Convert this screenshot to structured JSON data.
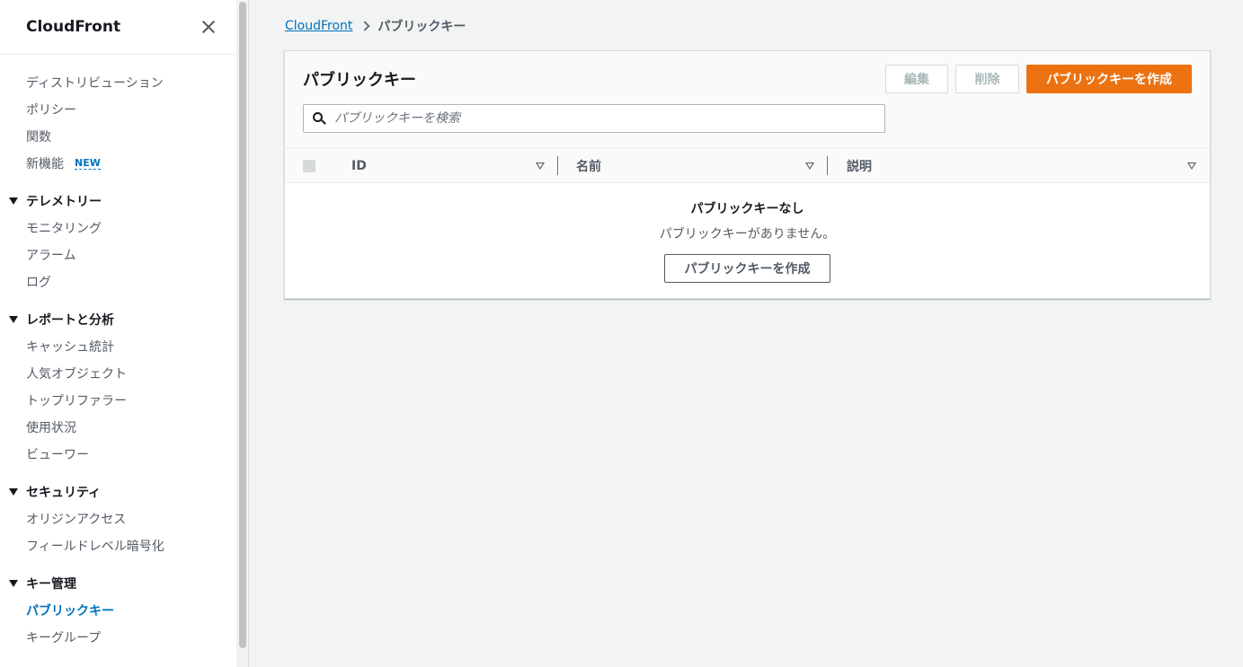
{
  "sidebar": {
    "title": "CloudFront",
    "items_top": [
      {
        "label": "ディストリビューション"
      },
      {
        "label": "ポリシー"
      },
      {
        "label": "関数"
      },
      {
        "label": "新機能",
        "badge": "NEW"
      }
    ],
    "sections": [
      {
        "label": "テレメトリー",
        "items": [
          "モニタリング",
          "アラーム",
          "ログ"
        ]
      },
      {
        "label": "レポートと分析",
        "items": [
          "キャッシュ統計",
          "人気オブジェクト",
          "トップリファラー",
          "使用状況",
          "ビューワー"
        ]
      },
      {
        "label": "セキュリティ",
        "items": [
          "オリジンアクセス",
          "フィールドレベル暗号化"
        ]
      },
      {
        "label": "キー管理",
        "items": [
          "パブリックキー",
          "キーグループ"
        ]
      }
    ],
    "active_item": "パブリックキー"
  },
  "breadcrumb": {
    "root": "CloudFront",
    "current": "パブリックキー"
  },
  "panel": {
    "title": "パブリックキー",
    "edit_label": "編集",
    "delete_label": "削除",
    "create_label": "パブリックキーを作成",
    "search_placeholder": "パブリックキーを検索",
    "columns": [
      "ID",
      "名前",
      "説明"
    ],
    "empty_title": "パブリックキーなし",
    "empty_desc": "パブリックキーがありません。",
    "empty_button": "パブリックキーを作成"
  },
  "colors": {
    "primary": "#ec7211",
    "link": "#0073bb"
  }
}
